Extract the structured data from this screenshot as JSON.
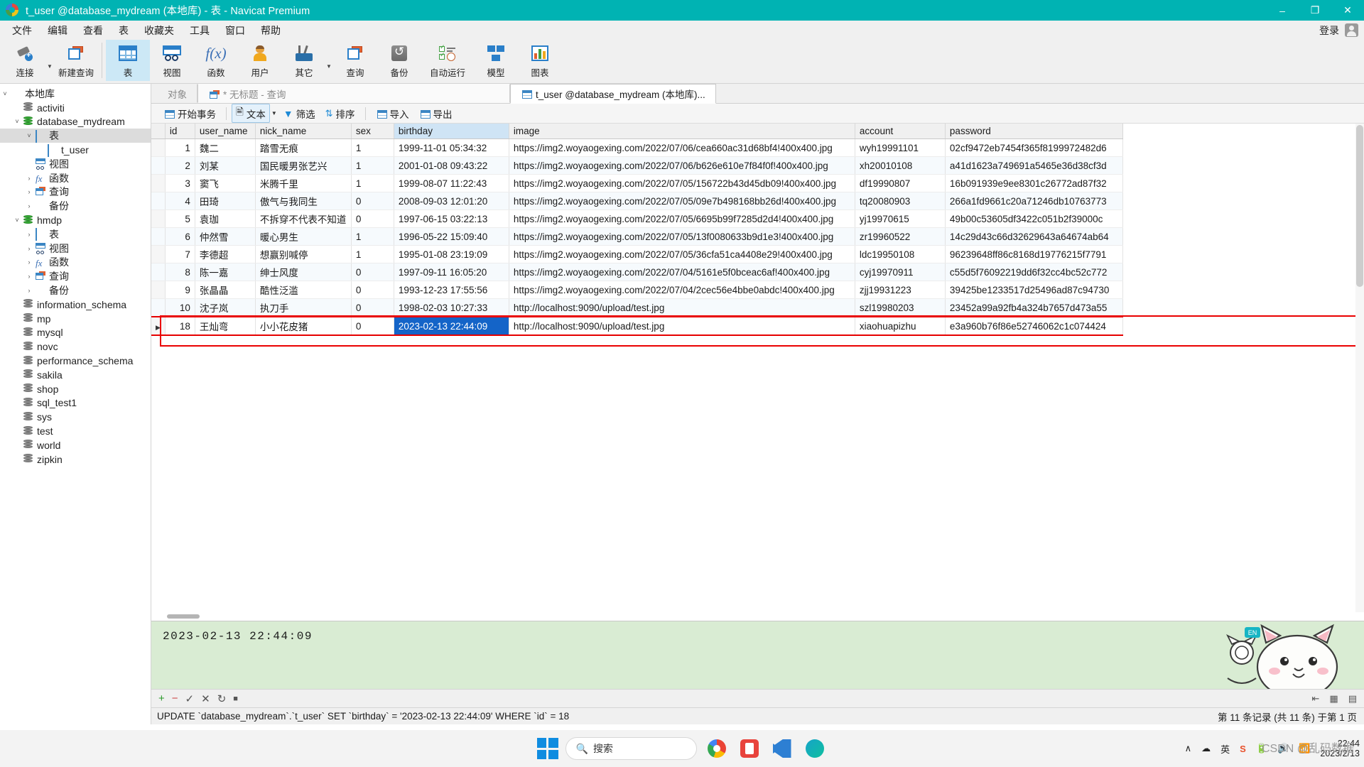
{
  "window": {
    "title": "t_user @database_mydream (本地库) - 表 - Navicat Premium",
    "minimize": "–",
    "maximize": "❐",
    "close": "✕"
  },
  "menubar": {
    "items": [
      "文件",
      "编辑",
      "查看",
      "表",
      "收藏夹",
      "工具",
      "窗口",
      "帮助"
    ],
    "login": "登录"
  },
  "ribbon": {
    "items": [
      {
        "label": "连接",
        "icon": "connection-icon",
        "caret": true
      },
      {
        "label": "新建查询",
        "icon": "new-query-icon",
        "caret": false
      },
      {
        "label": "表",
        "icon": "table-icon",
        "selected": true
      },
      {
        "label": "视图",
        "icon": "view-icon",
        "selected": false
      },
      {
        "label": "函数",
        "icon": "function-icon",
        "selected": false
      },
      {
        "label": "用户",
        "icon": "user-icon",
        "selected": false
      },
      {
        "label": "其它",
        "icon": "other-tools-icon",
        "caret": true
      },
      {
        "label": "查询",
        "icon": "query-icon",
        "selected": false
      },
      {
        "label": "备份",
        "icon": "backup-icon",
        "selected": false
      },
      {
        "label": "自动运行",
        "icon": "automation-icon",
        "selected": false
      },
      {
        "label": "模型",
        "icon": "model-icon",
        "selected": false
      },
      {
        "label": "图表",
        "icon": "chart-icon",
        "selected": false
      }
    ]
  },
  "sidebar": {
    "items": [
      {
        "label": "本地库",
        "indent": 0,
        "arrow": "open",
        "icon": "connection-green-icon",
        "selected": false
      },
      {
        "label": "activiti",
        "indent": 1,
        "arrow": "none",
        "icon": "database-icon",
        "selected": false
      },
      {
        "label": "database_mydream",
        "indent": 1,
        "arrow": "open",
        "icon": "database-green-icon",
        "selected": false
      },
      {
        "label": "表",
        "indent": 2,
        "arrow": "open",
        "icon": "table-icon",
        "selected": true
      },
      {
        "label": "t_user",
        "indent": 3,
        "arrow": "none",
        "icon": "table-icon",
        "selected": false
      },
      {
        "label": "视图",
        "indent": 2,
        "arrow": "none",
        "icon": "view-icon",
        "selected": false
      },
      {
        "label": "函数",
        "indent": 2,
        "arrow": "closed",
        "icon": "function-icon",
        "selected": false
      },
      {
        "label": "查询",
        "indent": 2,
        "arrow": "closed",
        "icon": "query-icon",
        "selected": false
      },
      {
        "label": "备份",
        "indent": 2,
        "arrow": "closed",
        "icon": "backup-icon",
        "selected": false
      },
      {
        "label": "hmdp",
        "indent": 1,
        "arrow": "open",
        "icon": "database-green-icon",
        "selected": false
      },
      {
        "label": "表",
        "indent": 2,
        "arrow": "closed",
        "icon": "table-icon",
        "selected": false
      },
      {
        "label": "视图",
        "indent": 2,
        "arrow": "closed",
        "icon": "view-icon",
        "selected": false
      },
      {
        "label": "函数",
        "indent": 2,
        "arrow": "closed",
        "icon": "function-icon",
        "selected": false
      },
      {
        "label": "查询",
        "indent": 2,
        "arrow": "closed",
        "icon": "query-icon",
        "selected": false
      },
      {
        "label": "备份",
        "indent": 2,
        "arrow": "closed",
        "icon": "backup-icon",
        "selected": false
      },
      {
        "label": "information_schema",
        "indent": 1,
        "arrow": "none",
        "icon": "database-icon",
        "selected": false
      },
      {
        "label": "mp",
        "indent": 1,
        "arrow": "none",
        "icon": "database-icon",
        "selected": false
      },
      {
        "label": "mysql",
        "indent": 1,
        "arrow": "none",
        "icon": "database-icon",
        "selected": false
      },
      {
        "label": "novc",
        "indent": 1,
        "arrow": "none",
        "icon": "database-icon",
        "selected": false
      },
      {
        "label": "performance_schema",
        "indent": 1,
        "arrow": "none",
        "icon": "database-icon",
        "selected": false
      },
      {
        "label": "sakila",
        "indent": 1,
        "arrow": "none",
        "icon": "database-icon",
        "selected": false
      },
      {
        "label": "shop",
        "indent": 1,
        "arrow": "none",
        "icon": "database-icon",
        "selected": false
      },
      {
        "label": "sql_test1",
        "indent": 1,
        "arrow": "none",
        "icon": "database-icon",
        "selected": false
      },
      {
        "label": "sys",
        "indent": 1,
        "arrow": "none",
        "icon": "database-icon",
        "selected": false
      },
      {
        "label": "test",
        "indent": 1,
        "arrow": "none",
        "icon": "database-icon",
        "selected": false
      },
      {
        "label": "world",
        "indent": 1,
        "arrow": "none",
        "icon": "database-icon",
        "selected": false
      },
      {
        "label": "zipkin",
        "indent": 1,
        "arrow": "none",
        "icon": "database-icon",
        "selected": false
      }
    ]
  },
  "tabs": {
    "objects": "对象",
    "query": "* 无标题 - 查询",
    "active": "t_user @database_mydream (本地库)..."
  },
  "grid_toolbar": {
    "begin_transaction": "开始事务",
    "text": "文本",
    "filter": "筛选",
    "sort": "排序",
    "import": "导入",
    "export": "导出"
  },
  "grid": {
    "columns": [
      "id",
      "user_name",
      "nick_name",
      "sex",
      "birthday",
      "image",
      "account",
      "password"
    ],
    "selected_column": "birthday",
    "rows": [
      {
        "id": "1",
        "user_name": "魏二",
        "nick_name": "踏雪无痕",
        "sex": "1",
        "birthday": "1999-11-01 05:34:32",
        "image": "https://img2.woyaogexing.com/2022/07/06/cea660ac31d68bf4!400x400.jpg",
        "account": "wyh19991101",
        "password": "02cf9472eb7454f365f8199972482d6"
      },
      {
        "id": "2",
        "user_name": "刘某",
        "nick_name": "国民暖男张艺兴",
        "sex": "1",
        "birthday": "2001-01-08 09:43:22",
        "image": "https://img2.woyaogexing.com/2022/07/06/b626e610e7f84f0f!400x400.jpg",
        "account": "xh20010108",
        "password": "a41d1623a749691a5465e36d38cf3d"
      },
      {
        "id": "3",
        "user_name": "窦飞",
        "nick_name": "米腾千里",
        "sex": "1",
        "birthday": "1999-08-07 11:22:43",
        "image": "https://img2.woyaogexing.com/2022/07/05/156722b43d45db09!400x400.jpg",
        "account": "df19990807",
        "password": "16b091939e9ee8301c26772ad87f32"
      },
      {
        "id": "4",
        "user_name": "田琦",
        "nick_name": "傲气与我同生",
        "sex": "0",
        "birthday": "2008-09-03 12:01:20",
        "image": "https://img2.woyaogexing.com/2022/07/05/09e7b498168bb26d!400x400.jpg",
        "account": "tq20080903",
        "password": "266a1fd9661c20a71246db10763773"
      },
      {
        "id": "5",
        "user_name": "袁珈",
        "nick_name": "不拆穿不代表不知道",
        "sex": "0",
        "birthday": "1997-06-15 03:22:13",
        "image": "https://img2.woyaogexing.com/2022/07/05/6695b99f7285d2d4!400x400.jpg",
        "account": "yj19970615",
        "password": "49b00c53605df3422c051b2f39000c"
      },
      {
        "id": "6",
        "user_name": "仲然雪",
        "nick_name": "暖心男生",
        "sex": "1",
        "birthday": "1996-05-22 15:09:40",
        "image": "https://img2.woyaogexing.com/2022/07/05/13f0080633b9d1e3!400x400.jpg",
        "account": "zr19960522",
        "password": "14c29d43c66d32629643a64674ab64"
      },
      {
        "id": "7",
        "user_name": "李德超",
        "nick_name": "想赢别喊停",
        "sex": "1",
        "birthday": "1995-01-08 23:19:09",
        "image": "https://img2.woyaogexing.com/2022/07/05/36cfa51ca4408e29!400x400.jpg",
        "account": "ldc19950108",
        "password": "96239648ff86c8168d19776215f7791"
      },
      {
        "id": "8",
        "user_name": "陈一嘉",
        "nick_name": "绅士风度",
        "sex": "0",
        "birthday": "1997-09-11 16:05:20",
        "image": "https://img2.woyaogexing.com/2022/07/04/5161e5f0bceac6af!400x400.jpg",
        "account": "cyj19970911",
        "password": "c55d5f76092219dd6f32cc4bc52c772"
      },
      {
        "id": "9",
        "user_name": "张晶晶",
        "nick_name": "酷性泛滥",
        "sex": "0",
        "birthday": "1993-12-23 17:55:56",
        "image": "https://img2.woyaogexing.com/2022/07/04/2cec56e4bbe0abdc!400x400.jpg",
        "account": "zjj19931223",
        "password": "39425be1233517d25496ad87c94730"
      },
      {
        "id": "10",
        "user_name": "沈子岚",
        "nick_name": "执刀手",
        "sex": "0",
        "birthday": "1998-02-03 10:27:33",
        "image": "http://localhost:9090/upload/test.jpg",
        "account": "szl19980203",
        "password": "23452a99a92fb4a324b7657d473a55"
      },
      {
        "id": "18",
        "user_name": "王灿弯",
        "nick_name": "小小花皮猪",
        "sex": "0",
        "birthday": "2023-02-13 22:44:09",
        "image": "http://localhost:9090/upload/test.jpg",
        "account": "xiaohuapizhu",
        "password": "e3a960b76f86e52746062c1c074424"
      }
    ]
  },
  "preview": {
    "value": "2023-02-13 22:44:09"
  },
  "editbar": {
    "add": "+",
    "remove": "−",
    "confirm": "✓",
    "cancel": "✕",
    "refresh": "↻",
    "stop": "■"
  },
  "statusbar": {
    "sql": "UPDATE `database_mydream`.`t_user` SET `birthday` = '2023-02-13 22:44:09' WHERE `id` = 18",
    "record_info": "第 11 条记录 (共 11 条) 于第 1 页"
  },
  "taskbar": {
    "search_placeholder": "搜索",
    "ime": "英",
    "time": "22:44",
    "date": "2023/2/13",
    "chevron": "∧"
  },
  "watermark": "CSDN @乱码数据",
  "colors": {
    "titlebar": "#00b3b3",
    "selection": "#1464c8",
    "edit_frame": "#ea0000",
    "preview_bg": "#d9ecd3",
    "header_selected": "#cfe4f5"
  }
}
